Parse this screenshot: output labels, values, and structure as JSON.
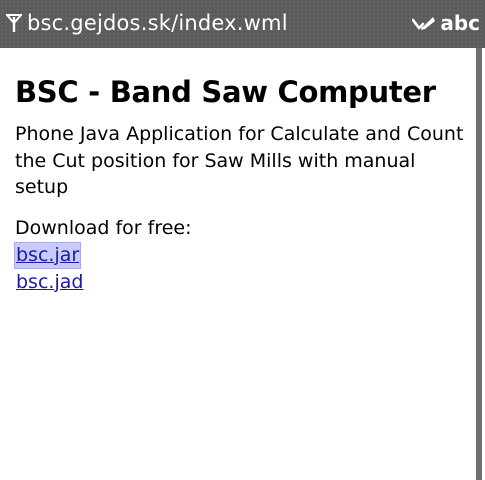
{
  "status_bar": {
    "url": "bsc.gejdos.sk/index.wml",
    "input_mode": "abc",
    "signal_icon": "antenna-icon",
    "edit_icon": "pen-input-icon",
    "background_color": "#5b5b5b"
  },
  "page": {
    "title": "BSC - Band Saw Computer",
    "description": "Phone Java Application for Calculate and Count the Cut position for Saw Mills with manual setup",
    "download_label": "Download for free:",
    "links": [
      {
        "label": "bsc.jar",
        "focused": true
      },
      {
        "label": "bsc.jad",
        "focused": false
      }
    ],
    "link_color": "#1a1aa6",
    "focus_color": "#c9cbf6"
  }
}
